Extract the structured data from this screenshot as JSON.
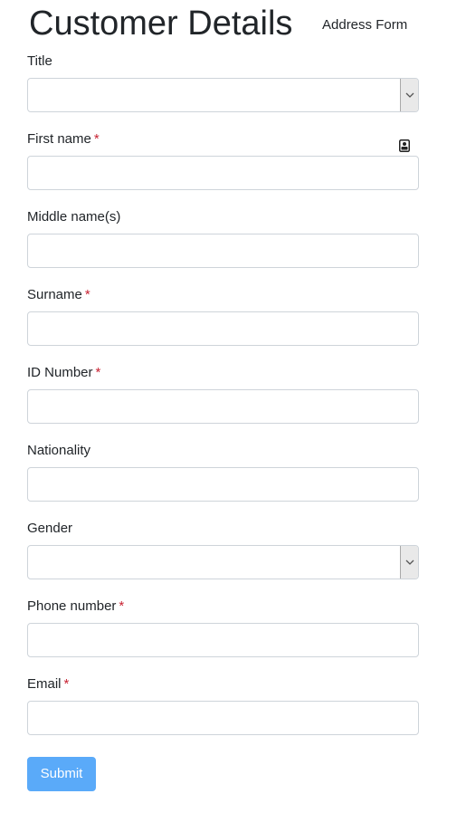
{
  "header": {
    "title": "Customer Details",
    "nav_link": "Address Form"
  },
  "form": {
    "fields": [
      {
        "label": "Title",
        "required": false,
        "type": "select",
        "value": ""
      },
      {
        "label": "First name",
        "required": true,
        "type": "text",
        "value": "",
        "icon": "contact-card-icon"
      },
      {
        "label": "Middle name(s)",
        "required": false,
        "type": "text",
        "value": ""
      },
      {
        "label": "Surname",
        "required": true,
        "type": "text",
        "value": ""
      },
      {
        "label": "ID Number",
        "required": true,
        "type": "text",
        "value": ""
      },
      {
        "label": "Nationality",
        "required": false,
        "type": "text",
        "value": ""
      },
      {
        "label": "Gender",
        "required": false,
        "type": "select",
        "value": ""
      },
      {
        "label": "Phone number",
        "required": true,
        "type": "text",
        "value": ""
      },
      {
        "label": "Email",
        "required": true,
        "type": "text",
        "value": ""
      }
    ],
    "required_marker": "*",
    "submit_label": "Submit"
  },
  "colors": {
    "required": "#c82333",
    "submit_bg": "#5aaaf9",
    "border": "#ced4da",
    "text": "#212529"
  }
}
